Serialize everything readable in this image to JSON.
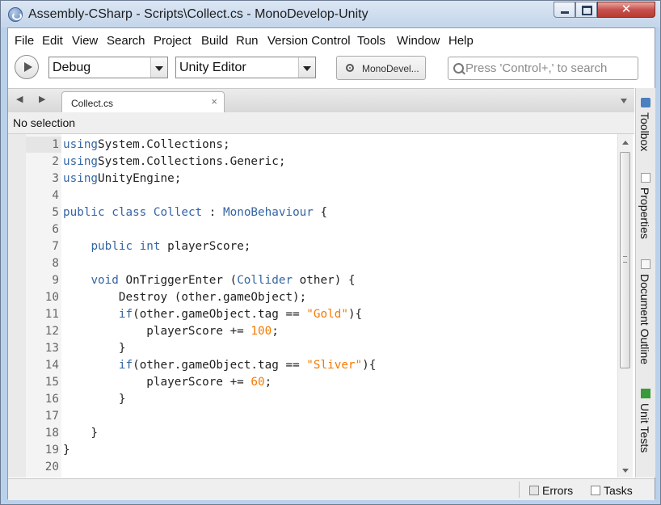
{
  "window": {
    "title": "Assembly-CSharp - Scripts\\Collect.cs - MonoDevelop-Unity",
    "close_glyph": "✕"
  },
  "menu": [
    "File",
    "Edit",
    "View",
    "Search",
    "Project",
    "Build",
    "Run",
    "Version Control",
    "Tools",
    "Window",
    "Help"
  ],
  "toolbar": {
    "configuration": "Debug",
    "target": "Unity Editor",
    "status": "MonoDevel...",
    "search_placeholder": "Press 'Control+,' to search"
  },
  "tab": {
    "label": "Collect.cs",
    "close_glyph": "×"
  },
  "path_bar": "No selection",
  "code_lines": [
    {
      "n": "1",
      "tokens": [
        [
          "kw",
          "using"
        ],
        [
          "",
          "System.Collections;"
        ]
      ]
    },
    {
      "n": "2",
      "tokens": [
        [
          "kw",
          "using"
        ],
        [
          "",
          "System.Collections.Generic;"
        ]
      ]
    },
    {
      "n": "3",
      "tokens": [
        [
          "kw",
          "using"
        ],
        [
          "",
          "UnityEngine;"
        ]
      ]
    },
    {
      "n": "4",
      "tokens": []
    },
    {
      "n": "5",
      "tokens": [
        [
          "kw",
          "public class "
        ],
        [
          "ty",
          "Collect"
        ],
        [
          "",
          " : "
        ],
        [
          "ty",
          "MonoBehaviour"
        ],
        [
          "",
          " {"
        ]
      ]
    },
    {
      "n": "6",
      "tokens": []
    },
    {
      "n": "7",
      "tokens": [
        [
          "",
          "    "
        ],
        [
          "kw",
          "public int"
        ],
        [
          "",
          " playerScore;"
        ]
      ]
    },
    {
      "n": "8",
      "tokens": []
    },
    {
      "n": "9",
      "tokens": [
        [
          "",
          "    "
        ],
        [
          "kw",
          "void"
        ],
        [
          "",
          " OnTriggerEnter ("
        ],
        [
          "ty",
          "Collider"
        ],
        [
          "",
          " other) {"
        ]
      ]
    },
    {
      "n": "10",
      "tokens": [
        [
          "",
          "        Destroy (other.gameObject);"
        ]
      ]
    },
    {
      "n": "11",
      "tokens": [
        [
          "",
          "        "
        ],
        [
          "kw",
          "if"
        ],
        [
          "",
          "(other.gameObject.tag == "
        ],
        [
          "str",
          "\"Gold\""
        ],
        [
          "",
          "){"
        ]
      ]
    },
    {
      "n": "12",
      "tokens": [
        [
          "",
          "            playerScore += "
        ],
        [
          "numc",
          "100"
        ],
        [
          "",
          ";"
        ]
      ]
    },
    {
      "n": "13",
      "tokens": [
        [
          "",
          "        }"
        ]
      ]
    },
    {
      "n": "14",
      "tokens": [
        [
          "",
          "        "
        ],
        [
          "kw",
          "if"
        ],
        [
          "",
          "(other.gameObject.tag == "
        ],
        [
          "str",
          "\"Sliver\""
        ],
        [
          "",
          "){"
        ]
      ]
    },
    {
      "n": "15",
      "tokens": [
        [
          "",
          "            playerScore += "
        ],
        [
          "numc",
          "60"
        ],
        [
          "",
          ";"
        ]
      ]
    },
    {
      "n": "16",
      "tokens": [
        [
          "",
          "        }"
        ]
      ]
    },
    {
      "n": "17",
      "tokens": []
    },
    {
      "n": "18",
      "tokens": [
        [
          "",
          "    }"
        ]
      ]
    },
    {
      "n": "19",
      "tokens": [
        [
          "",
          "}"
        ]
      ]
    },
    {
      "n": "20",
      "tokens": []
    }
  ],
  "dock_pads": [
    {
      "label": "Toolbox",
      "icon": "toolbox-icon",
      "color": "#4a7fc0"
    },
    {
      "label": "Properties",
      "icon": "properties-icon",
      "color": "#9a9a9a"
    },
    {
      "label": "Document Outline",
      "icon": "document-outline-icon",
      "color": "#9a9a9a"
    },
    {
      "label": "Unit Tests",
      "icon": "unit-tests-icon",
      "color": "#3a9a3a"
    }
  ],
  "status_bar": {
    "errors": "Errors",
    "tasks": "Tasks"
  },
  "colors": {
    "keyword": "#3465a4",
    "string": "#f57900",
    "number": "#f57900"
  }
}
